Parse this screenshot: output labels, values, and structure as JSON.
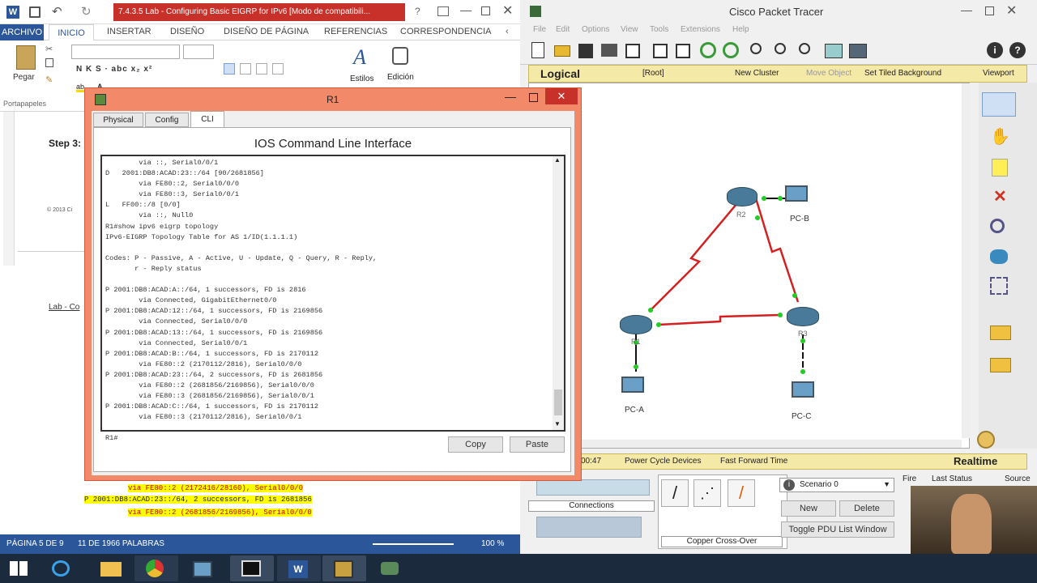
{
  "word": {
    "title": "7.4.3.5 Lab - Configuring Basic EIGRP for IPv6 [Modo de compatibili...",
    "quick_help": "?",
    "tabs": [
      "ARCHIVO",
      "INICIO",
      "INSERTAR",
      "DISEÑO",
      "DISEÑO DE PÁGINA",
      "REFERENCIAS",
      "CORRESPONDENCIA"
    ],
    "ribbon": {
      "paste_label": "Pegar",
      "clipboard_label": "Portapapeles",
      "styles_label": "Estilos",
      "edit_label": "Edición",
      "font_tools": "N  K  S  · abc  x₂  x²"
    },
    "doc": {
      "step": "Step 3:",
      "copyright": "© 2013 Ci",
      "footer_label": "Lab - Co",
      "lines": [
        "via FE80::2 (2172416/28160), Serial0/0/0",
        "P 2001:DB8:ACAD:23::/64, 2 successors, FD is 2681856",
        "via FE80::2 (2681856/2169856), Serial0/0/0"
      ]
    },
    "status": {
      "page": "PÁGINA 5 DE 9",
      "words": "11 DE 1966 PALABRAS",
      "zoom": "100 %"
    }
  },
  "pt": {
    "title": "Cisco Packet Tracer",
    "menu": [
      "File",
      "Edit",
      "Options",
      "View",
      "Tools",
      "Extensions",
      "Help"
    ],
    "logical_bar": {
      "logical": "Logical",
      "root": "[Root]",
      "new_cluster": "New Cluster",
      "move_object": "Move Object",
      "tiled_bg": "Set Tiled Background",
      "viewport": "Viewport"
    },
    "devices": {
      "r2": "R2",
      "pcb": "PC-B",
      "pca": "PC-A",
      "pcc": "PC-C",
      "r1": "R1",
      "r3": "R3"
    },
    "time_bar": {
      "time": "00:47",
      "power": "Power Cycle Devices",
      "ffwd": "Fast Forward Time",
      "realtime": "Realtime"
    },
    "bottom": {
      "connections": "Connections",
      "cable_label": "Copper Cross-Over",
      "scenario": "Scenario 0",
      "new_btn": "New",
      "delete_btn": "Delete",
      "toggle_btn": "Toggle PDU List Window",
      "cols": [
        "Fire",
        "Last Status",
        "Source"
      ]
    }
  },
  "r1_window": {
    "title": "R1",
    "tabs": [
      "Physical",
      "Config",
      "CLI"
    ],
    "heading": "IOS Command Line Interface",
    "cli_lines": [
      "        via ::, Serial0/0/1",
      "D   2001:DB8:ACAD:23::/64 [90/2681856]",
      "        via FE80::2, Serial0/0/0",
      "        via FE80::3, Serial0/0/1",
      "L   FF00::/8 [0/0]",
      "        via ::, Null0",
      "R1#show ipv6 eigrp topology",
      "IPv6-EIGRP Topology Table for AS 1/ID(1.1.1.1)",
      "",
      "Codes: P - Passive, A - Active, U - Update, Q - Query, R - Reply,",
      "       r - Reply status",
      "",
      "P 2001:DB8:ACAD:A::/64, 1 successors, FD is 2816",
      "        via Connected, GigabitEthernet0/0",
      "P 2001:DB8:ACAD:12::/64, 1 successors, FD is 2169856",
      "        via Connected, Serial0/0/0",
      "P 2001:DB8:ACAD:13::/64, 1 successors, FD is 2169856",
      "        via Connected, Serial0/0/1",
      "P 2001:DB8:ACAD:B::/64, 1 successors, FD is 2170112",
      "        via FE80::2 (2170112/2816), Serial0/0/0",
      "P 2001:DB8:ACAD:23::/64, 2 successors, FD is 2681856",
      "        via FE80::2 (2681856/2169856), Serial0/0/0",
      "        via FE80::3 (2681856/2169856), Serial0/0/1",
      "P 2001:DB8:ACAD:C::/64, 1 successors, FD is 2170112",
      "        via FE80::3 (2170112/2816), Serial0/0/1",
      "",
      "R1#"
    ],
    "copy_btn": "Copy",
    "paste_btn": "Paste"
  },
  "colors": {
    "word_blue": "#2b579a",
    "dialog_orange": "#f28a6a",
    "link_red": "#d42020",
    "link_green": "#22cc22",
    "logical_bar": "#f5e9a8"
  },
  "icons": {
    "start": "windows-start-icon",
    "ie": "internet-explorer-icon",
    "chrome": "chrome-icon",
    "explorer": "file-explorer-icon",
    "word": "word-icon"
  }
}
